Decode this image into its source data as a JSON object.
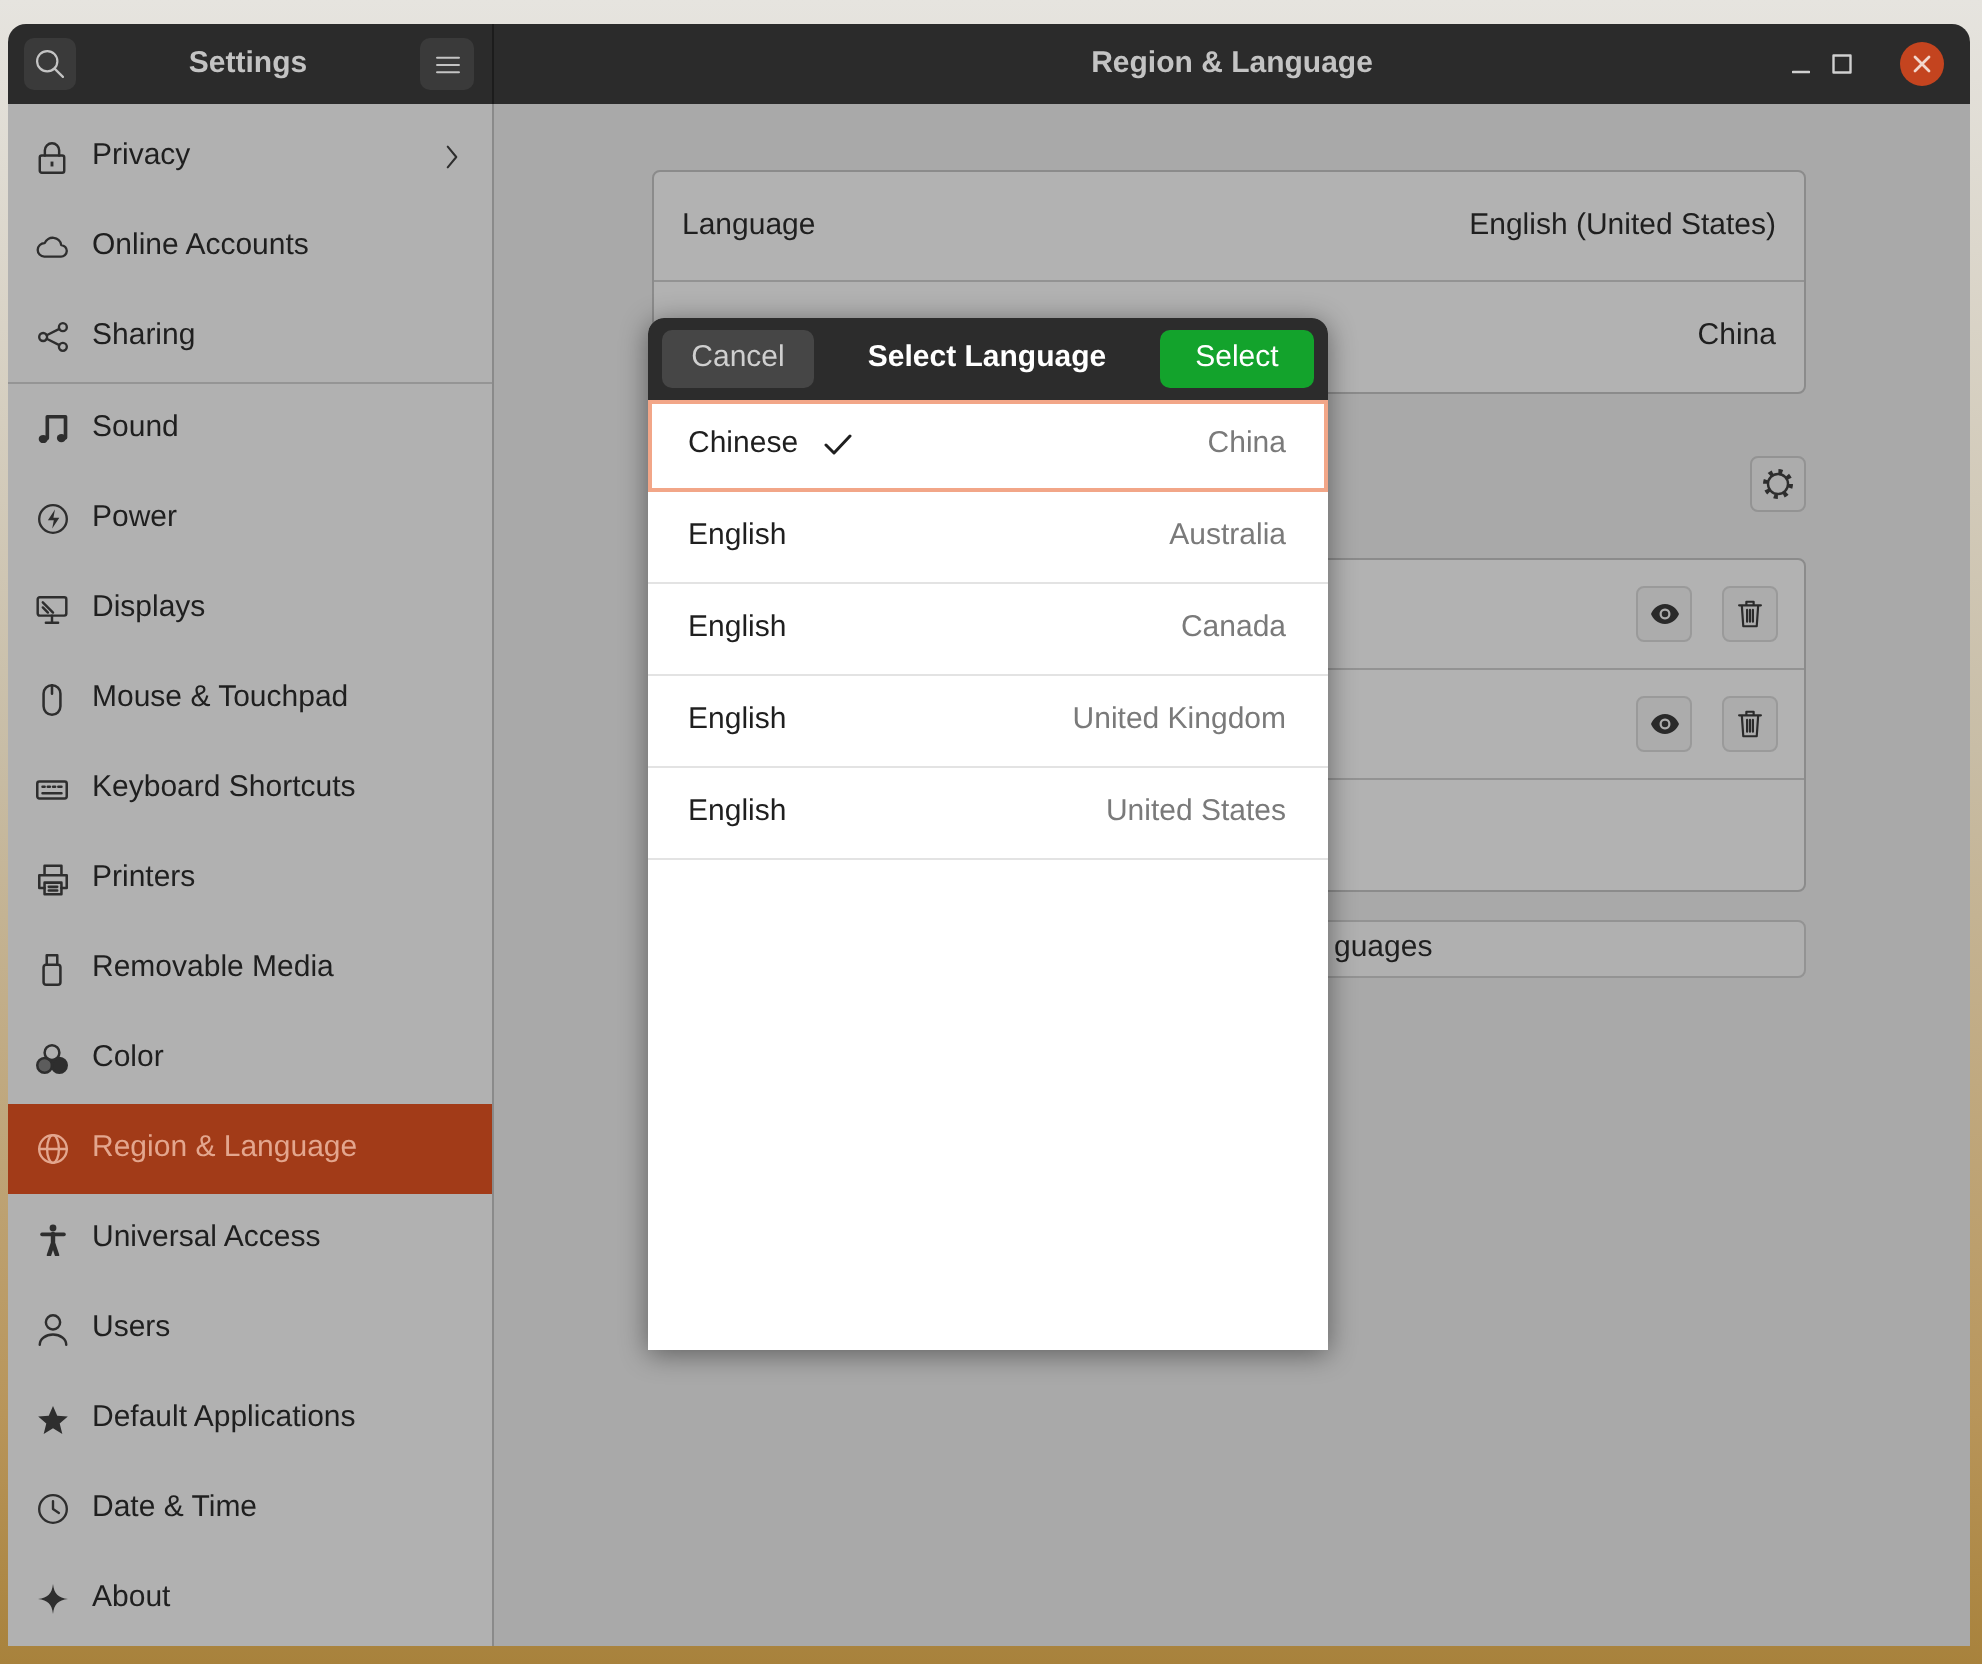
{
  "window": {
    "title": "Region & Language"
  },
  "sidebar": {
    "title": "Settings",
    "groups": [
      {
        "items": [
          {
            "label": "Privacy",
            "has_subpage": true,
            "selected": false
          },
          {
            "label": "Online Accounts",
            "has_subpage": false,
            "selected": false
          },
          {
            "label": "Sharing",
            "has_subpage": false,
            "selected": false
          }
        ]
      },
      {
        "items": [
          {
            "label": "Sound",
            "has_subpage": false,
            "selected": false
          },
          {
            "label": "Power",
            "has_subpage": false,
            "selected": false
          },
          {
            "label": "Displays",
            "has_subpage": false,
            "selected": false
          },
          {
            "label": "Mouse & Touchpad",
            "has_subpage": false,
            "selected": false
          },
          {
            "label": "Keyboard Shortcuts",
            "has_subpage": false,
            "selected": false
          },
          {
            "label": "Printers",
            "has_subpage": false,
            "selected": false
          },
          {
            "label": "Removable Media",
            "has_subpage": false,
            "selected": false
          },
          {
            "label": "Color",
            "has_subpage": false,
            "selected": false
          },
          {
            "label": "Region & Language",
            "has_subpage": false,
            "selected": true
          },
          {
            "label": "Universal Access",
            "has_subpage": false,
            "selected": false
          },
          {
            "label": "Users",
            "has_subpage": false,
            "selected": false
          },
          {
            "label": "Default Applications",
            "has_subpage": false,
            "selected": false
          },
          {
            "label": "Date & Time",
            "has_subpage": false,
            "selected": false
          },
          {
            "label": "About",
            "has_subpage": false,
            "selected": false
          }
        ]
      }
    ]
  },
  "settings_list": [
    {
      "label": "Language",
      "value": "English (United States)"
    },
    {
      "value": "China"
    }
  ],
  "input_sources": [
    {
      "kind": "source"
    },
    {
      "kind": "source"
    },
    {
      "kind": "add"
    }
  ],
  "manage_button": {
    "label": "guages"
  },
  "dialog": {
    "title": "Select Language",
    "cancel": "Cancel",
    "confirm": "Select",
    "languages": [
      {
        "language": "Chinese",
        "country": "China",
        "selected": true
      },
      {
        "language": "English",
        "country": "Australia",
        "selected": false
      },
      {
        "language": "English",
        "country": "Canada",
        "selected": false
      },
      {
        "language": "English",
        "country": "United Kingdom",
        "selected": false
      },
      {
        "language": "English",
        "country": "United States",
        "selected": false
      }
    ]
  }
}
